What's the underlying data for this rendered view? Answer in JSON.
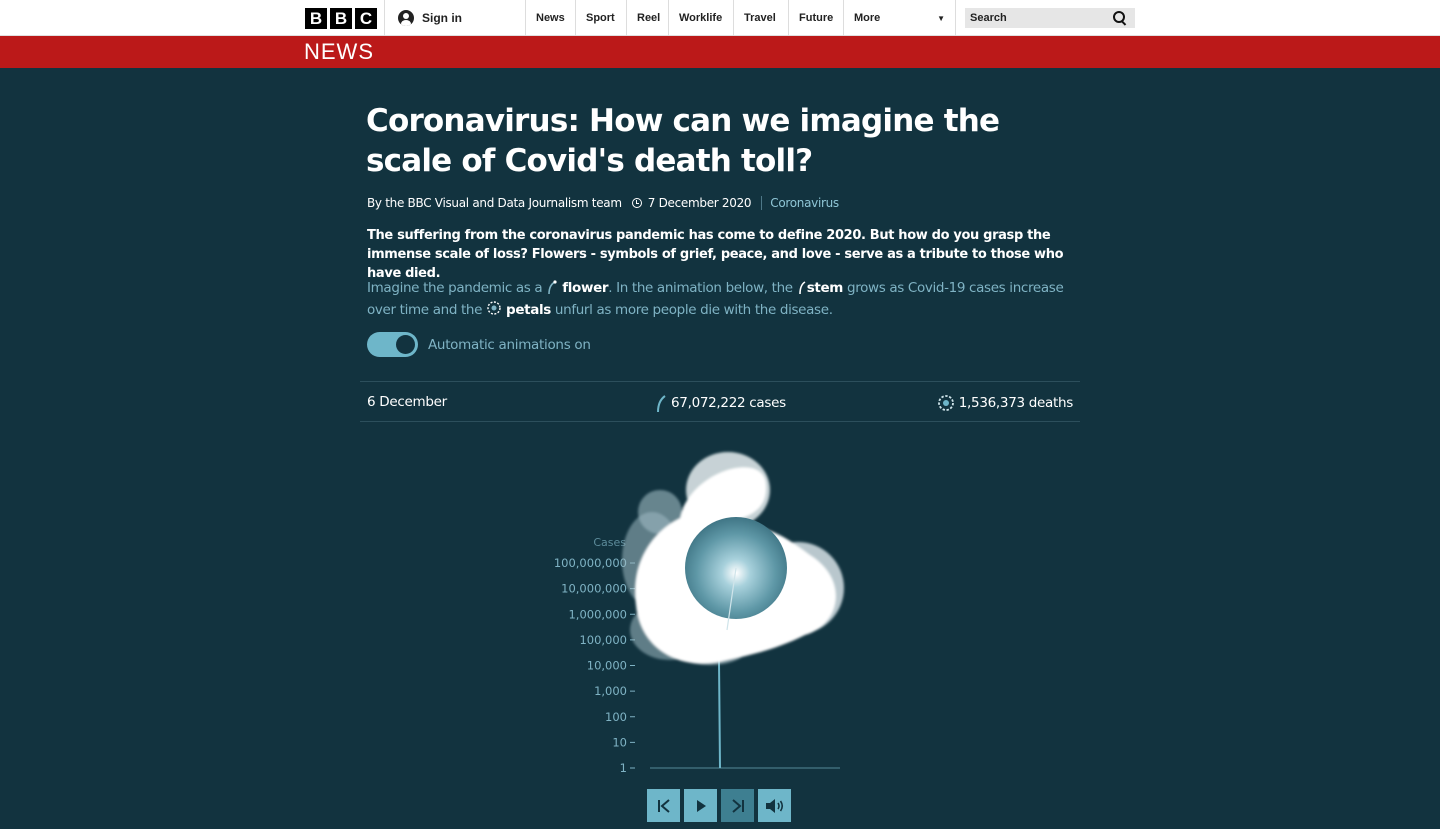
{
  "header": {
    "logo_letters": [
      "B",
      "B",
      "C"
    ],
    "sign_in": "Sign in",
    "nav": [
      "News",
      "Sport",
      "Reel",
      "Worklife",
      "Travel",
      "Future"
    ],
    "more": "More",
    "search_placeholder": "Search",
    "section": "NEWS"
  },
  "article": {
    "title": "Coronavirus: How can we imagine the scale of Covid's death toll?",
    "byline": "By the BBC Visual and Data Journalism team",
    "date": "7 December 2020",
    "topic": "Coronavirus",
    "intro": "The suffering from the coronavirus pandemic has come to define 2020. But how do you grasp the immense scale of loss? Flowers - symbols of grief, peace, and love - serve as a tribute to those who have died.",
    "explain": {
      "p1": "Imagine the pandemic as a",
      "flower": "flower",
      "p2": ". In the animation below, the",
      "stem": "stem",
      "p3": "grows as Covid-19 cases increase over time and the",
      "petals": "petals",
      "p4": "unfurl as more people die with the disease."
    },
    "toggle_label": "Automatic animations on",
    "toggle_on": true
  },
  "stats": {
    "date": "6 December",
    "cases": "67,072,222 cases",
    "deaths": "1,536,373 deaths"
  },
  "chart_data": {
    "type": "line",
    "ylabel": "Cases",
    "yscale": "log",
    "yticks": [
      "100,000,000",
      "10,000,000",
      "1,000,000",
      "100,000",
      "10,000",
      "1,000",
      "100",
      "10",
      "1"
    ],
    "ytick_values": [
      100000000,
      10000000,
      1000000,
      100000,
      10000,
      1000,
      100,
      10,
      1
    ],
    "current_cases": 67072222,
    "current_deaths": 1536373
  },
  "colors": {
    "background": "#12333f",
    "accent": "#6eb6c9",
    "news_red": "#bb1919"
  },
  "controls": [
    "skip-back-icon",
    "play-icon",
    "skip-forward-icon",
    "volume-icon"
  ]
}
